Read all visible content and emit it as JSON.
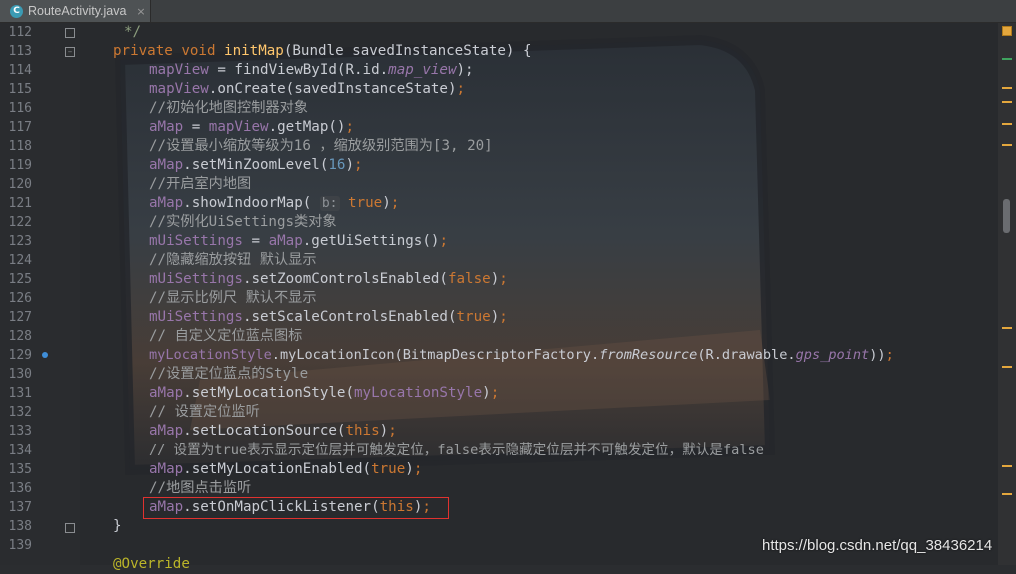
{
  "tab": {
    "icon_letter": "C",
    "filename": "RouteActivity.java",
    "close_glyph": "×"
  },
  "editor": {
    "line_numbers": [
      "112",
      "113",
      "114",
      "115",
      "116",
      "117",
      "118",
      "119",
      "120",
      "121",
      "122",
      "123",
      "124",
      "125",
      "126",
      "127",
      "128",
      "129",
      "130",
      "131",
      "132",
      "133",
      "134",
      "135",
      "136",
      "137",
      "138",
      "139"
    ],
    "code": {
      "l112": "*/",
      "l113_a": "private void ",
      "l113_b": "initMap",
      "l113_c": "(Bundle savedInstanceState) {",
      "l114_a": "mapView",
      "l114_b": " = findViewById(R.id.",
      "l114_c": "map_view",
      "l114_d": ");",
      "l115_a": "mapView",
      "l115_b": ".onCreate(savedInstanceState)",
      "l115_c": ";",
      "l116": "//初始化地图控制器对象",
      "l117_a": "aMap",
      "l117_b": " = ",
      "l117_c": "mapView",
      "l117_d": ".getMap()",
      "l117_e": ";",
      "l118": "//设置最小缩放等级为16 ，缩放级别范围为[3, 20]",
      "l119_a": "aMap",
      "l119_b": ".setMinZoomLevel(",
      "l119_c": "16",
      "l119_d": ")",
      "l119_e": ";",
      "l120": "//开启室内地图",
      "l121_a": "aMap",
      "l121_b": ".showIndoorMap( ",
      "l121_hint": "b:",
      "l121_c": " true",
      "l121_d": ")",
      "l121_e": ";",
      "l122": "//实例化UiSettings类对象",
      "l123_a": "mUiSettings",
      "l123_b": " = ",
      "l123_c": "aMap",
      "l123_d": ".getUiSettings()",
      "l123_e": ";",
      "l124": "//隐藏缩放按钮 默认显示",
      "l125_a": "mUiSettings",
      "l125_b": ".setZoomControlsEnabled(",
      "l125_c": "false",
      "l125_d": ")",
      "l125_e": ";",
      "l126": "//显示比例尺 默认不显示",
      "l127_a": "mUiSettings",
      "l127_b": ".setScaleControlsEnabled(",
      "l127_c": "true",
      "l127_d": ")",
      "l127_e": ";",
      "l128": "// 自定义定位蓝点图标",
      "l129_a": "myLocationStyle",
      "l129_b": ".myLocationIcon(BitmapDescriptorFactory.",
      "l129_c": "fromResource",
      "l129_d": "(R.drawable.",
      "l129_e": "gps_point",
      "l129_f": "))",
      "l129_g": ";",
      "l130": "//设置定位蓝点的Style",
      "l131_a": "aMap",
      "l131_b": ".setMyLocationStyle(",
      "l131_c": "myLocationStyle",
      "l131_d": ")",
      "l131_e": ";",
      "l132": "// 设置定位监听",
      "l133_a": "aMap",
      "l133_b": ".setLocationSource(",
      "l133_c": "this",
      "l133_d": ")",
      "l133_e": ";",
      "l134": "// 设置为true表示显示定位层并可触发定位，false表示隐藏定位层并不可触发定位，默认是false",
      "l135_a": "aMap",
      "l135_b": ".setMyLocationEnabled(",
      "l135_c": "true",
      "l135_d": ")",
      "l135_e": ";",
      "l136": "//地图点击监听",
      "l137_a": "aMap",
      "l137_b": ".setOnMapClickListener(",
      "l137_c": "this",
      "l137_d": ")",
      "l137_e": ";",
      "l138": "}",
      "l139": "@Override"
    }
  },
  "watermark": "https://blog.csdn.net/qq_38436214",
  "colors": {
    "keyword": "#cc7832",
    "field": "#9876aa",
    "method_decl": "#ffc66d",
    "comment": "#9a9d9f",
    "highlight_box": "#e0322f",
    "marker": "#e4a73d"
  }
}
